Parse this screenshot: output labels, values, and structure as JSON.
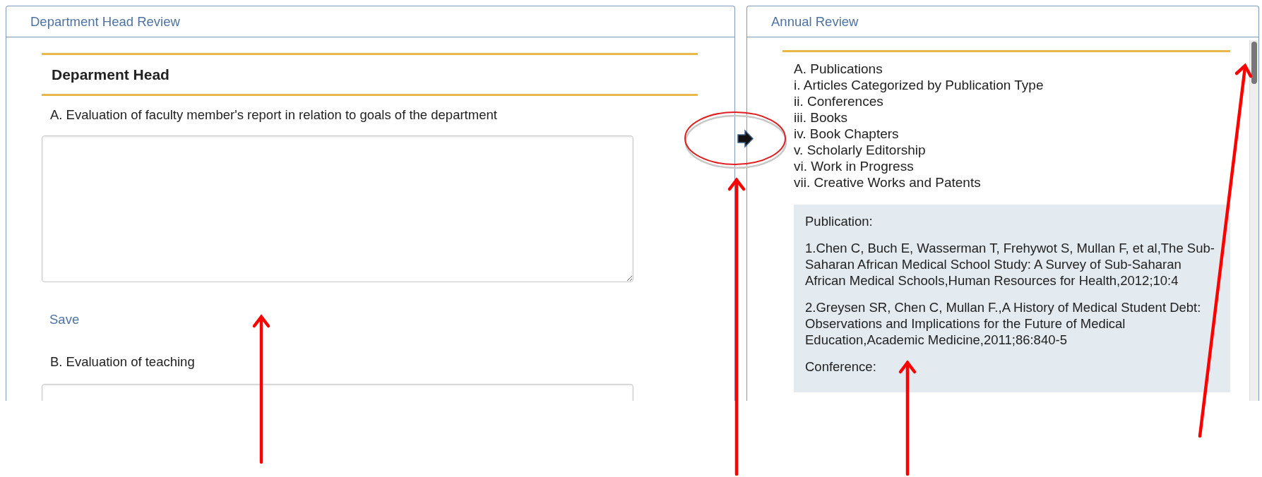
{
  "left_panel": {
    "title": "Department Head Review",
    "section_heading": "Deparment Head",
    "questions": [
      {
        "label": "A. Evaluation of faculty member's report in relation to goals of the department",
        "action": "Save"
      },
      {
        "label": "B. Evaluation of teaching"
      }
    ]
  },
  "right_panel": {
    "title": "Annual Review",
    "outline": [
      "A. Publications",
      "i. Articles Categorized by Publication Type",
      "ii. Conferences",
      "iii. Books",
      "iv. Book Chapters",
      "v. Scholarly Editorship",
      "vi. Work in Progress",
      "vii. Creative Works and Patents"
    ],
    "details": [
      "Publication:",
      "1.Chen C, Buch E, Wasserman T, Frehywot S, Mullan F, et al,The Sub-Saharan African Medical School Study: A Survey of Sub-Saharan African Medical Schools,Human Resources for Health,2012;10:4",
      "2.Greysen SR, Chen C, Mullan F.,A History of Medical Student Debt: Observations and Implications for the Future of Medical Education,Academic Medicine,2011;86:840-5",
      "Conference:"
    ]
  }
}
